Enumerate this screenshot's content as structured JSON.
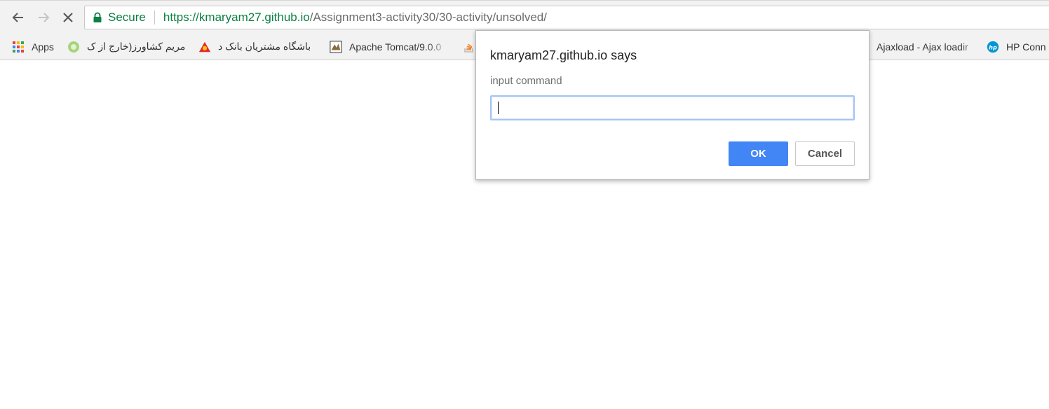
{
  "browser": {
    "nav": {
      "back_icon": "arrow-left-icon",
      "forward_icon": "arrow-right-icon",
      "stop_icon": "close-icon"
    },
    "omnibox": {
      "secure_label": "Secure",
      "url_scheme": "https://",
      "url_host": "kmaryam27.github.io",
      "url_path": "/Assignment3-activity30/30-activity/unsolved/",
      "lock_icon": "lock-icon",
      "secure_color": "#0b8043"
    },
    "bookmarks": [
      {
        "label": "Apps",
        "icon": "apps-grid-icon"
      },
      {
        "label": "مریم کشاورز(خارج از ک",
        "icon": "green-globe-icon"
      },
      {
        "label": "باشگاه مشتریان بانک د",
        "icon": "bank-logo-icon"
      },
      {
        "label": "Apache Tomcat/9.0.0",
        "icon": "tomcat-icon"
      },
      {
        "label": "",
        "icon": "stackoverflow-icon"
      },
      {
        "label": "Ajaxload - Ajax loadir",
        "icon": "bookmark-page-icon"
      },
      {
        "label": "HP Conn",
        "icon": "hp-logo-icon"
      }
    ]
  },
  "dialog": {
    "title": "kmaryam27.github.io says",
    "message": "input command",
    "input_value": "",
    "ok_label": "OK",
    "cancel_label": "Cancel",
    "ok_color": "#4285f4"
  }
}
